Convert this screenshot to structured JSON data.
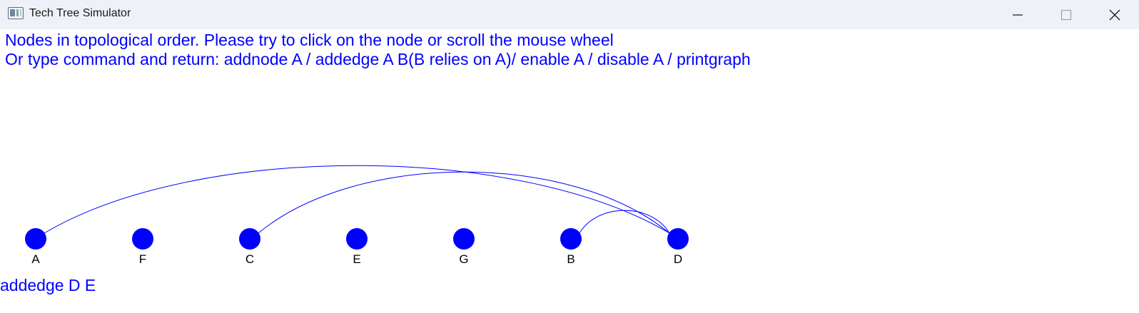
{
  "window": {
    "title": "Tech Tree Simulator",
    "icon": "app-window-icon",
    "controls": [
      "minimize-icon",
      "maximize-icon",
      "close-icon"
    ]
  },
  "instructions": {
    "line1": "Nodes in topological order. Please try to click on the node or scroll the mouse wheel",
    "line2": "Or type command and return: addnode A / addedge A B(B relies on A)/ enable A / disable A / printgraph"
  },
  "graph": {
    "node_color": "#0000ff",
    "edge_color": "#0000ff",
    "nodes": [
      "A",
      "F",
      "C",
      "E",
      "G",
      "B",
      "D"
    ],
    "edges": [
      {
        "from": "A",
        "to": "D"
      },
      {
        "from": "C",
        "to": "D"
      },
      {
        "from": "B",
        "to": "D"
      }
    ]
  },
  "command_input": {
    "value": "addedge D E"
  },
  "colors": {
    "text_accent": "#0000ff",
    "titlebar_bg": "#eef2f8"
  }
}
